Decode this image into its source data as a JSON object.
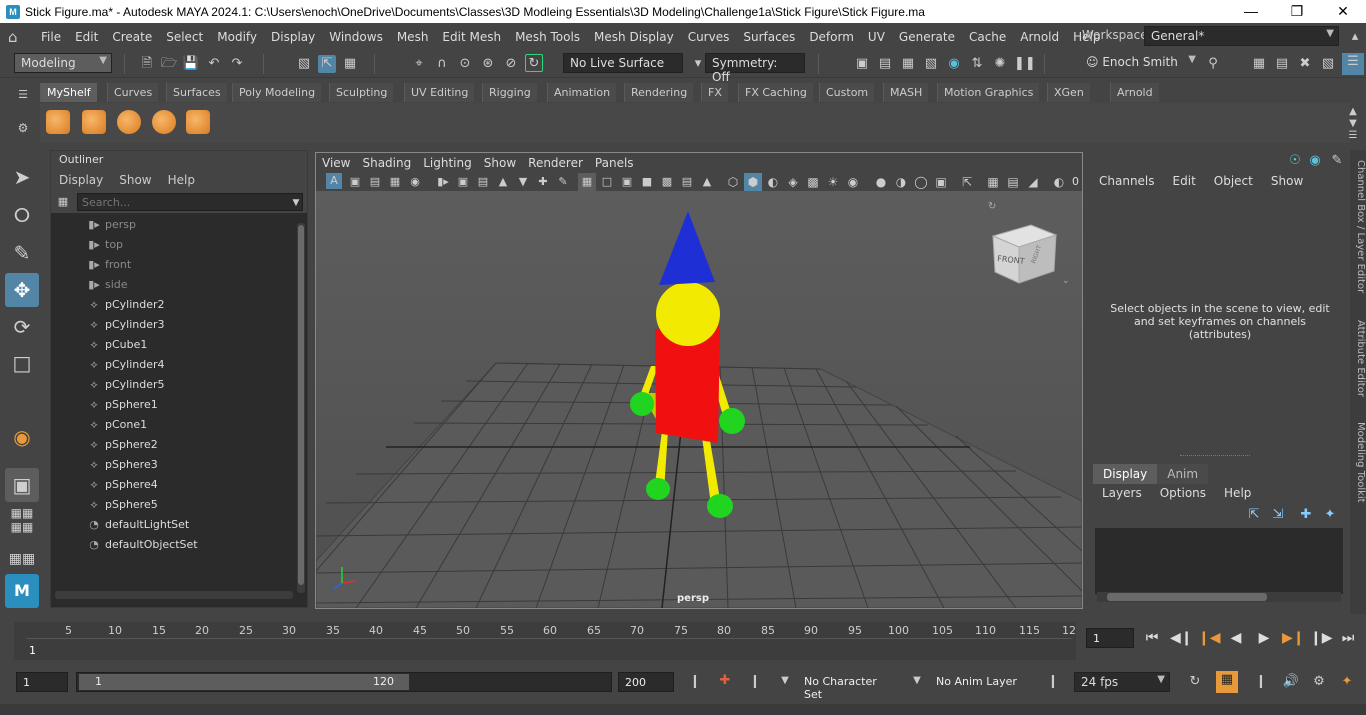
{
  "window": {
    "title": "Stick Figure.ma* - Autodesk MAYA 2024.1: C:\\Users\\enoch\\OneDrive\\Documents\\Classes\\3D Modleing Essentials\\3D Modeling\\Challenge1a\\Stick Figure\\Stick Figure.ma",
    "app_icon": "M"
  },
  "menubar": {
    "items": [
      "File",
      "Edit",
      "Create",
      "Select",
      "Modify",
      "Display",
      "Windows",
      "Mesh",
      "Edit Mesh",
      "Mesh Tools",
      "Mesh Display",
      "Curves",
      "Surfaces",
      "Deform",
      "UV",
      "Generate",
      "Cache",
      "Arnold",
      "Help"
    ],
    "workspace_label": "Workspace:",
    "workspace_value": "General*"
  },
  "statusline": {
    "menu_set": "Modeling",
    "live_surface": "No Live Surface",
    "symmetry": "Symmetry: Off",
    "user": "Enoch Smith"
  },
  "shelf": {
    "tabs": [
      "MyShelf",
      "Curves",
      "Surfaces",
      "Poly Modeling",
      "Sculpting",
      "UV Editing",
      "Rigging",
      "Animation",
      "Rendering",
      "FX",
      "FX Caching",
      "Custom",
      "MASH",
      "Motion Graphics",
      "XGen",
      "Arnold"
    ],
    "active_tab": "MyShelf"
  },
  "outliner": {
    "title": "Outliner",
    "menu": [
      "Display",
      "Show",
      "Help"
    ],
    "search_placeholder": "Search...",
    "items": [
      {
        "label": "persp",
        "icon": "camera-icon",
        "dim": true
      },
      {
        "label": "top",
        "icon": "camera-icon",
        "dim": true
      },
      {
        "label": "front",
        "icon": "camera-icon",
        "dim": true
      },
      {
        "label": "side",
        "icon": "camera-icon",
        "dim": true
      },
      {
        "label": "pCylinder2",
        "icon": "mesh-icon",
        "dim": false
      },
      {
        "label": "pCylinder3",
        "icon": "mesh-icon",
        "dim": false
      },
      {
        "label": "pCube1",
        "icon": "mesh-icon",
        "dim": false
      },
      {
        "label": "pCylinder4",
        "icon": "mesh-icon",
        "dim": false
      },
      {
        "label": "pCylinder5",
        "icon": "mesh-icon",
        "dim": false
      },
      {
        "label": "pSphere1",
        "icon": "mesh-icon",
        "dim": false
      },
      {
        "label": "pCone1",
        "icon": "mesh-icon",
        "dim": false
      },
      {
        "label": "pSphere2",
        "icon": "mesh-icon",
        "dim": false
      },
      {
        "label": "pSphere3",
        "icon": "mesh-icon",
        "dim": false
      },
      {
        "label": "pSphere4",
        "icon": "mesh-icon",
        "dim": false
      },
      {
        "label": "pSphere5",
        "icon": "mesh-icon",
        "dim": false
      },
      {
        "label": "defaultLightSet",
        "icon": "set-icon",
        "dim": false
      },
      {
        "label": "defaultObjectSet",
        "icon": "set-icon",
        "dim": false
      }
    ]
  },
  "viewport": {
    "menu": [
      "View",
      "Shading",
      "Lighting",
      "Show",
      "Renderer",
      "Panels"
    ],
    "camera_label": "persp",
    "viewcube_front": "FRONT",
    "viewcube_right": "RIGHT",
    "extra_value": "0",
    "colors": {
      "cone": "#1e2fd6",
      "head": "#f2ea00",
      "body": "#f01010",
      "limbs": "#f2ea00",
      "hands": "#20d420"
    }
  },
  "channelbox": {
    "menu": [
      "Channels",
      "Edit",
      "Object",
      "Show"
    ],
    "message": "Select objects in the scene to view, edit and set keyframes on channels (attributes)"
  },
  "side_tabs": [
    "Channel Box / Layer Editor",
    "Attribute Editor",
    "Modeling Toolkit"
  ],
  "layer_editor": {
    "tabs": [
      "Display",
      "Anim"
    ],
    "active_tab": "Display",
    "menu": [
      "Layers",
      "Options",
      "Help"
    ]
  },
  "timeslider": {
    "ticks": [
      "5",
      "10",
      "15",
      "20",
      "25",
      "30",
      "35",
      "40",
      "45",
      "50",
      "55",
      "60",
      "65",
      "70",
      "75",
      "80",
      "85",
      "90",
      "95",
      "100",
      "105",
      "110",
      "115",
      "12"
    ],
    "start_label": "1",
    "current_frame": "1"
  },
  "rangeslider": {
    "start_time": "1",
    "range_start": "1",
    "range_end": "120",
    "end_time": "200",
    "character_set": "No Character Set",
    "anim_layer": "No Anim Layer",
    "fps": "24 fps"
  }
}
